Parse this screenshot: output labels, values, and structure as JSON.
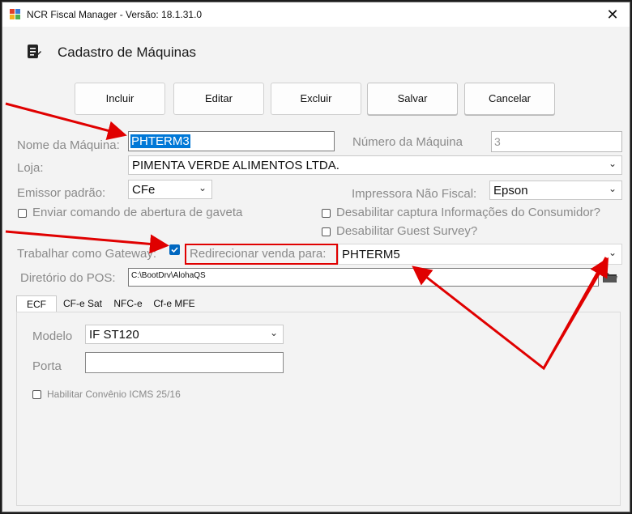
{
  "window": {
    "title": "NCR Fiscal Manager - Versão: 18.1.31.0",
    "close_symbol": "✕",
    "page_title": "Cadastro de Máquinas"
  },
  "toolbar": {
    "incluir": "Incluir",
    "editar": "Editar",
    "excluir": "Excluir",
    "salvar": "Salvar",
    "cancelar": "Cancelar"
  },
  "form": {
    "nome_label": "Nome da Máquina:",
    "nome_value": "PHTERM3",
    "numero_label": "Número da Máquina",
    "numero_value": "3",
    "loja_label": "Loja:",
    "loja_value": "PIMENTA VERDE ALIMENTOS LTDA.",
    "emissor_label": "Emissor padrão:",
    "emissor_value": "CFe",
    "impressora_label": "Impressora Não Fiscal:",
    "impressora_value": "Epson",
    "gaveta_label": "Enviar comando de abertura de gaveta",
    "captura_label": "Desabilitar captura Informações do Consumidor?",
    "guest_label": "Desabilitar Guest Survey?",
    "gateway_label": "Trabalhar como Gateway:",
    "redirecionar_label": "Redirecionar venda para:",
    "redirecionar_value": "PHTERM5",
    "diretorio_label": "Diretório do POS:",
    "diretorio_value": "C:\\BootDrv\\AlohaQS",
    "chevron": "⌄"
  },
  "tabs": [
    "ECF",
    "CF-e Sat",
    "NFC-e",
    "Cf-e MFE"
  ],
  "ecf": {
    "modelo_label": "Modelo",
    "modelo_value": "IF ST120",
    "porta_label": "Porta",
    "porta_value": "",
    "convenio_label": "Habilitar Convênio ICMS 25/16"
  },
  "colors": {
    "annotation_red": "#e00000",
    "selection_blue": "#0078d7",
    "checkbox_blue": "#0067c0"
  },
  "icons": {
    "app": "app-icon",
    "page": "document-icon",
    "folder": "folder-icon"
  }
}
